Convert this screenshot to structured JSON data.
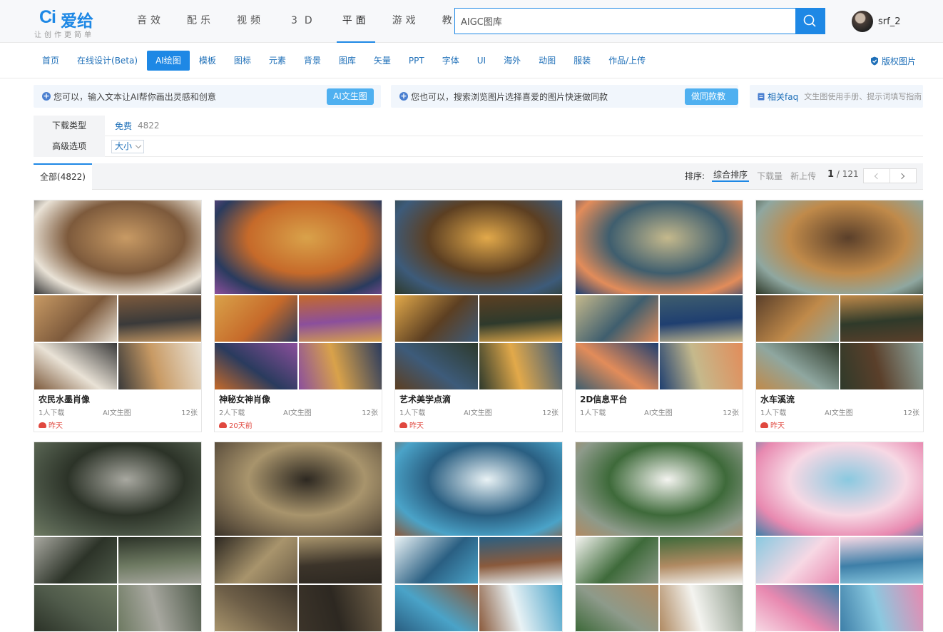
{
  "header": {
    "logo_mark": "Ci",
    "logo_text": "爱给",
    "slogan": "让创作更简单",
    "nav": [
      "音效",
      "配乐",
      "视频",
      "3D",
      "平面",
      "游戏",
      "教程"
    ],
    "nav_active": 4,
    "search_value": "AIGC图库",
    "user_name": "srf_2"
  },
  "categories": [
    "首页",
    "在线设计(Beta)",
    "AI绘图",
    "模板",
    "图标",
    "元素",
    "背景",
    "图库",
    "矢量",
    "PPT",
    "字体",
    "UI",
    "海外",
    "动图",
    "服装",
    "作品/上传"
  ],
  "category_active": 2,
  "copyright_label": "版权图片",
  "tips": {
    "tip1": "您可以，输入文本让AI帮你画出灵感和创意",
    "tip1_btn": "AI文生图",
    "tip2": "您也可以，搜索浏览图片选择喜爱的图片快速做同款",
    "tip2_btn": "做同款教程",
    "tip3": "相关faq",
    "tip3_sub": "文生图使用手册、提示词填写指南"
  },
  "filters": {
    "type_label": "下载类型",
    "type_value": "免费",
    "type_count": "4822",
    "adv_label": "高级选项",
    "adv_value": "大小"
  },
  "sortbar": {
    "tab_all": "全部(4822)",
    "sort_label": "排序:",
    "sort_options": [
      "综合排序",
      "下载量",
      "新上传"
    ],
    "sort_active": 0,
    "page_current": "1",
    "page_total": "/ 121"
  },
  "cards": [
    {
      "title": "农民水墨肖像",
      "downloads": "1人下载",
      "kind": "AI文生图",
      "count": "12张",
      "time": "昨天",
      "palette": [
        "#e9e2d6",
        "#c89a64",
        "#7d5a3c",
        "#3a3a3a"
      ]
    },
    {
      "title": "神秘女神肖像",
      "downloads": "2人下载",
      "kind": "AI文生图",
      "count": "12张",
      "time": "20天前",
      "palette": [
        "#2a3b5e",
        "#d9a24a",
        "#c66a2a",
        "#8b4f9c"
      ]
    },
    {
      "title": "艺术美学点滴",
      "downloads": "1人下载",
      "kind": "AI文生图",
      "count": "12张",
      "time": "昨天",
      "palette": [
        "#3d5b7a",
        "#e2a94a",
        "#5c3f22",
        "#2e3a2c"
      ]
    },
    {
      "title": "2D信息平台",
      "downloads": "1人下载",
      "kind": "AI文生图",
      "count": "12张",
      "time": "",
      "palette": [
        "#e28c5a",
        "#c5b98c",
        "#3f5e6e",
        "#1f3f70"
      ]
    },
    {
      "title": "水车溪流",
      "downloads": "1人下载",
      "kind": "AI文生图",
      "count": "12张",
      "time": "昨天",
      "palette": [
        "#8fa7a0",
        "#5a3f2a",
        "#c08a4a",
        "#2f3a2a"
      ]
    },
    {
      "title": "",
      "downloads": "",
      "kind": "",
      "count": "",
      "time": "",
      "palette": [
        "#4f5a4a",
        "#a8a8a0",
        "#2c3328",
        "#6e7a62"
      ]
    },
    {
      "title": "",
      "downloads": "",
      "kind": "",
      "count": "",
      "time": "",
      "palette": [
        "#6e5f48",
        "#2d2821",
        "#a8946c",
        "#3c342a"
      ]
    },
    {
      "title": "",
      "downloads": "",
      "kind": "",
      "count": "",
      "time": "",
      "palette": [
        "#4aa3c8",
        "#e9f2f5",
        "#2a5f82",
        "#8a5a3c"
      ]
    },
    {
      "title": "",
      "downloads": "",
      "kind": "",
      "count": "",
      "time": "",
      "palette": [
        "#8d9a8a",
        "#f4f4f0",
        "#3e6a3a",
        "#b08a62"
      ]
    },
    {
      "title": "",
      "downloads": "",
      "kind": "",
      "count": "",
      "time": "",
      "palette": [
        "#e889b0",
        "#8ac9e0",
        "#f7d8e4",
        "#3e7fa8"
      ]
    }
  ]
}
